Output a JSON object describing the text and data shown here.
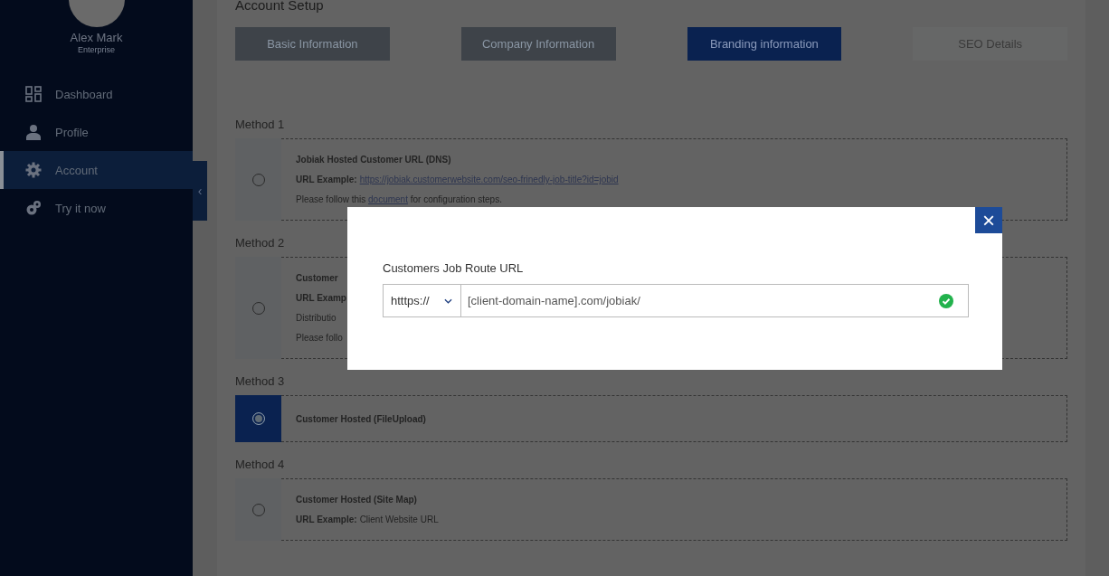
{
  "sidebar": {
    "user": {
      "name": "Alex Mark",
      "plan": "Enterprise"
    },
    "items": [
      {
        "label": "Dashboard",
        "kind": "grid",
        "selected": false
      },
      {
        "label": "Profile",
        "kind": "person",
        "selected": false
      },
      {
        "label": "Account",
        "kind": "gear",
        "selected": true
      },
      {
        "label": "Try it now",
        "kind": "gears",
        "selected": false
      }
    ],
    "collapse": "‹"
  },
  "page": {
    "title": "Account Setup",
    "tabs": [
      {
        "label": "Basic Information",
        "selected": false,
        "completed": true
      },
      {
        "label": "Company Information",
        "selected": false,
        "completed": true
      },
      {
        "label": "Branding information",
        "selected": true
      },
      {
        "label": "SEO Details",
        "selected": false,
        "completed": false
      }
    ],
    "methods": [
      {
        "label": "Method 1",
        "selected": false,
        "lines": [
          {
            "kind": "title",
            "text": "Jobiak Hosted Customer URL (DNS)"
          },
          {
            "kind": "field",
            "label": "URL Example:",
            "link": "https://jobiak.customerwebsite.com/seo-frinedly-job-title?id=jobid"
          },
          {
            "kind": "note",
            "before": "Please follow this",
            "link": "document",
            "after": "for configuration steps."
          }
        ]
      },
      {
        "label": "Method 2",
        "selected": false,
        "lines": [
          {
            "kind": "title",
            "text": "Customer"
          },
          {
            "kind": "field",
            "label": "URL Examp"
          },
          {
            "kind": "plain",
            "text": "Distributio"
          },
          {
            "kind": "plain",
            "text": "Please follo"
          }
        ]
      },
      {
        "label": "Method 3",
        "selected": true,
        "lines": [
          {
            "kind": "title",
            "text": "Customer Hosted (FileUpload)"
          }
        ]
      },
      {
        "label": "Method 4",
        "selected": false,
        "lines": [
          {
            "kind": "title",
            "text": "Customer Hosted (Site Map)"
          },
          {
            "kind": "field",
            "label": "URL Example:",
            "value": "Client Website URL"
          }
        ]
      }
    ]
  },
  "modal": {
    "close": "×",
    "label": "Customers Job Route URL",
    "protocol": "htttps://",
    "value": "[client-domain-name].com/jobiak/",
    "valid": true
  }
}
